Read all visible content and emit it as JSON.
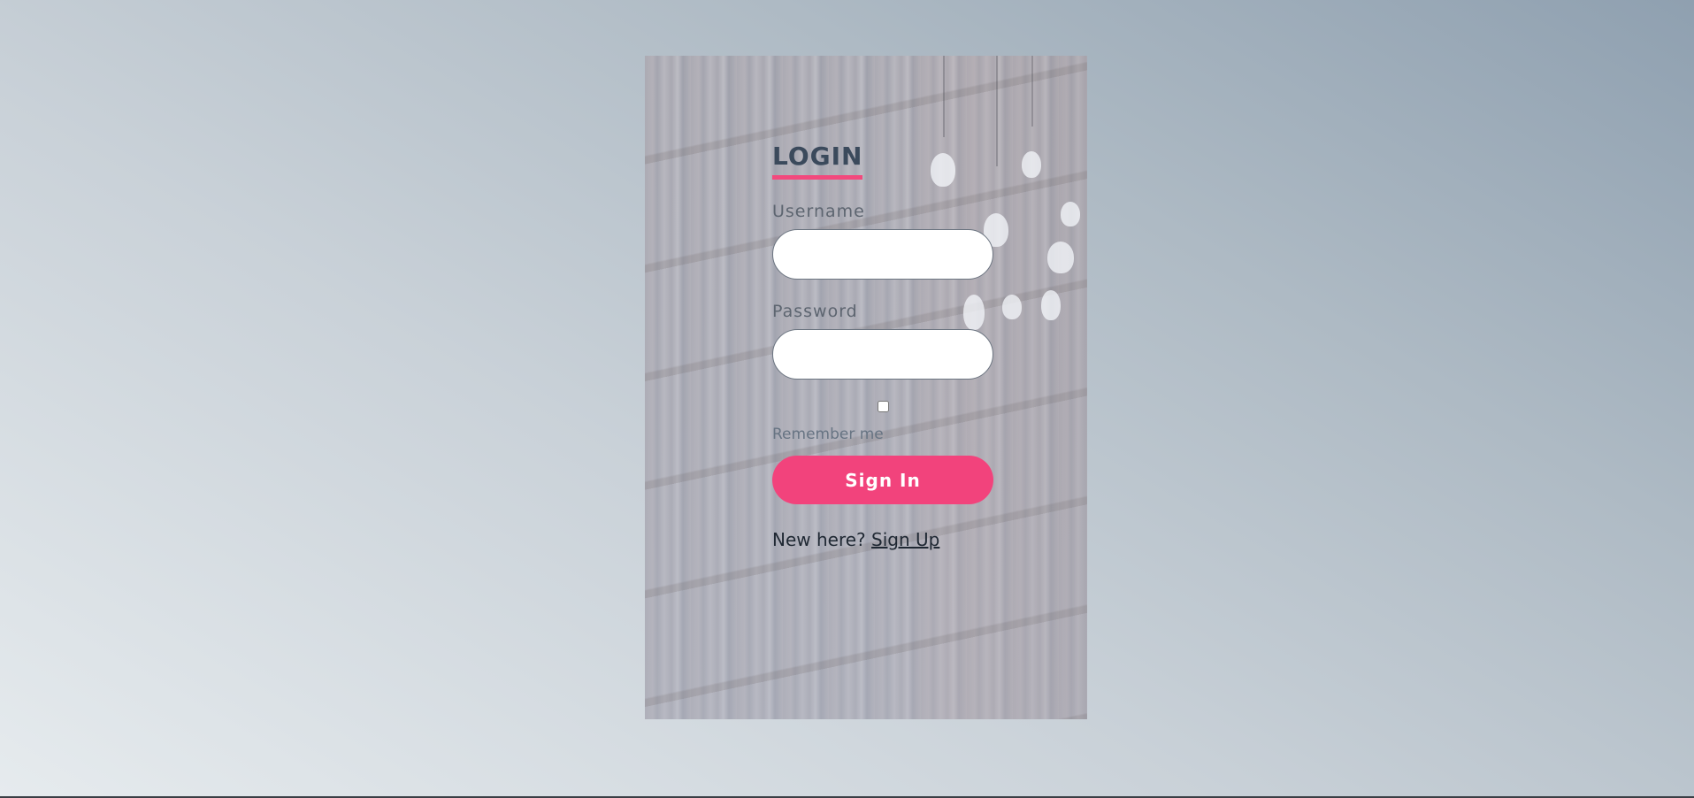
{
  "login": {
    "title": "LOGIN",
    "username_label": "Username",
    "username_value": "",
    "password_label": "Password",
    "password_value": "",
    "remember_label": "Remember me",
    "remember_checked": false,
    "sign_in_label": "Sign In",
    "signup_prompt": "New here?",
    "signup_link": "Sign Up"
  },
  "colors": {
    "accent": "#f2437c",
    "title": "#3b4a5c",
    "label": "#5d6570"
  }
}
